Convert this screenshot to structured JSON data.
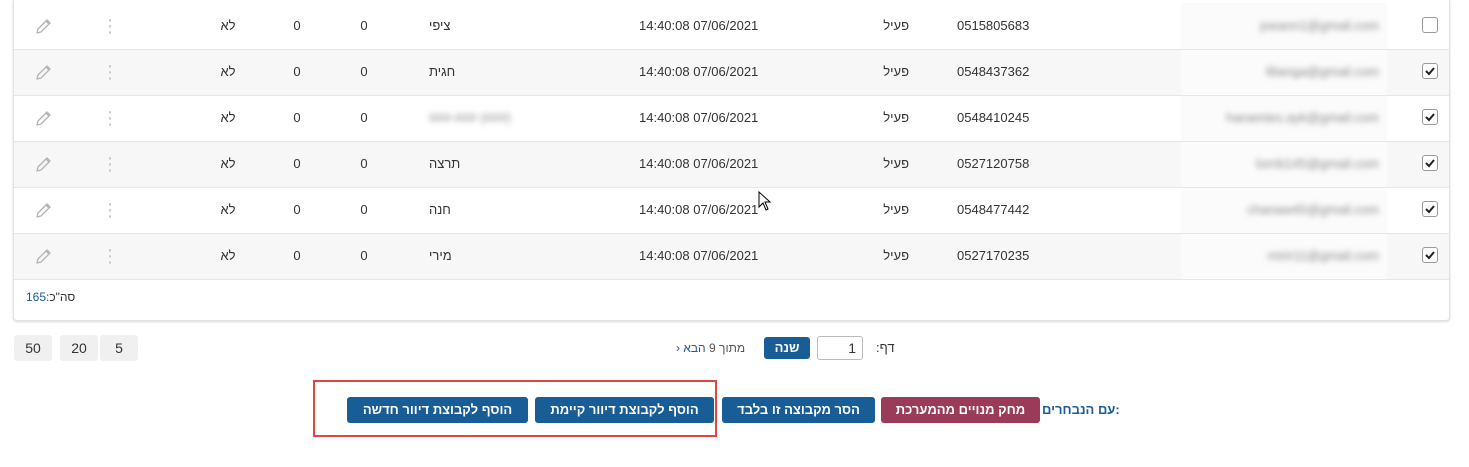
{
  "table": {
    "rows": [
      {
        "checked": false,
        "email": "joeann1@gmail.com",
        "phone": "0515805683",
        "status": "פעיל",
        "date": "14:40:08 07/06/2021",
        "name": "ציפי",
        "n1": "0",
        "n2": "0",
        "flag": "לא",
        "name_blurred": false
      },
      {
        "checked": true,
        "email": "lilianga@gmail.com",
        "phone": "0548437362",
        "status": "פעיל",
        "date": "14:40:08 07/06/2021",
        "name": "חגית",
        "n1": "0",
        "n2": "0",
        "flag": "לא",
        "name_blurred": false
      },
      {
        "checked": true,
        "email": "hanamies.ayk@gmail.com",
        "phone": "0548410245",
        "status": "פעיל",
        "date": "14:40:08 07/06/2021",
        "name": "(###) ###-###",
        "n1": "0",
        "n2": "0",
        "flag": "לא",
        "name_blurred": true
      },
      {
        "checked": true,
        "email": "lornb145@gmail.com",
        "phone": "0527120758",
        "status": "פעיל",
        "date": "14:40:08 07/06/2021",
        "name": "תרצה",
        "n1": "0",
        "n2": "0",
        "flag": "לא",
        "name_blurred": false
      },
      {
        "checked": true,
        "email": "chanaw45@gmail.com",
        "phone": "0548477442",
        "status": "פעיל",
        "date": "14:40:08 07/06/2021",
        "name": "חנה",
        "n1": "0",
        "n2": "0",
        "flag": "לא",
        "name_blurred": false
      },
      {
        "checked": true,
        "email": "mirir11@gmail.com",
        "phone": "0527170235",
        "status": "פעיל",
        "date": "14:40:08 07/06/2021",
        "name": "מירי",
        "n1": "0",
        "n2": "0",
        "flag": "לא",
        "name_blurred": false
      }
    ],
    "total_label": "סה\"כ:",
    "total_value": "165"
  },
  "per_page": {
    "options": [
      "50",
      "20",
      "5"
    ]
  },
  "pager": {
    "label": "דף:",
    "page_value": "1",
    "go_label": "שנה",
    "of_text": "מתוך 9",
    "next_label": "הבא"
  },
  "actions": {
    "with_selected_label": "עם הנבחרים:",
    "delete_label": "מחק מנויים מהמערכת",
    "remove_group_label": "הסר מקבוצה זו בלבד",
    "add_existing_label": "הוסף לקבוצת דיוור קיימת",
    "add_new_label": "הוסף לקבוצת דיוור חדשה"
  },
  "colors": {
    "primary": "#185d95",
    "danger": "#9a3b5a",
    "highlight": "#e24444"
  }
}
